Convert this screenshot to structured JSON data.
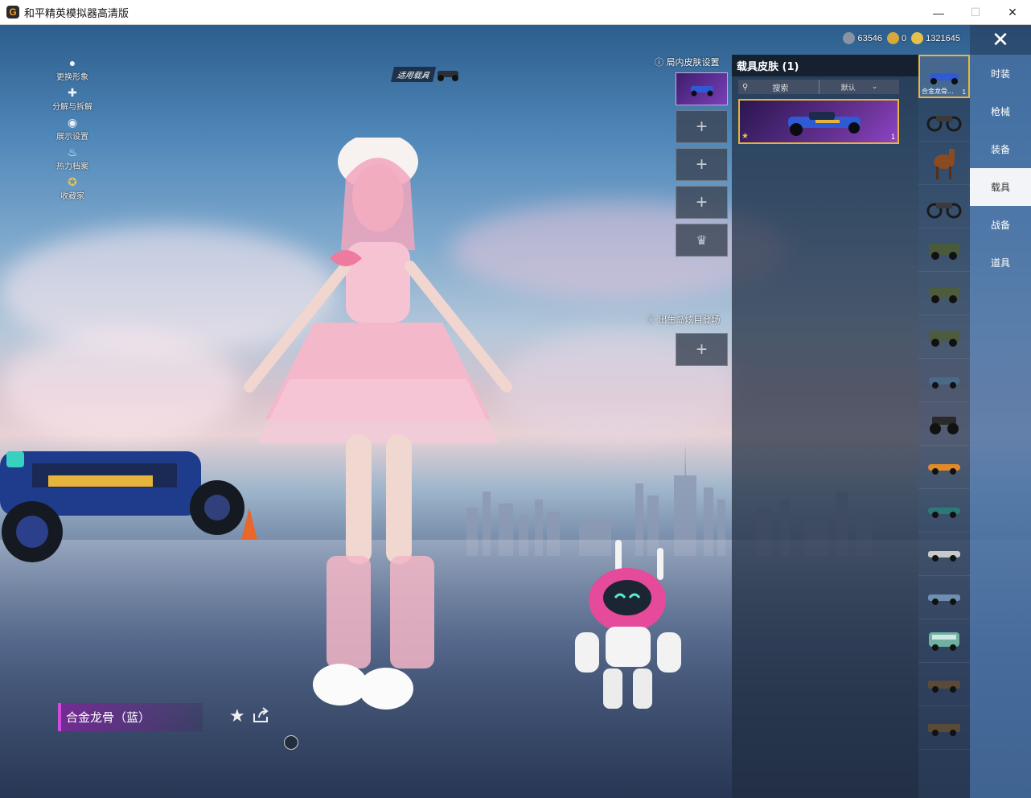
{
  "window": {
    "title": "和平精英模拟器高清版",
    "minimize": "—",
    "maximize": "☐",
    "close": "✕"
  },
  "left_menu": [
    {
      "label": "更换形象",
      "icon": "avatar-icon"
    },
    {
      "label": "分解与拆解",
      "icon": "puzzle-icon"
    },
    {
      "label": "展示设置",
      "icon": "eye-icon"
    },
    {
      "label": "热力档案",
      "icon": "flame-icon"
    },
    {
      "label": "收藏家",
      "icon": "collector-badge-icon"
    }
  ],
  "apply_vehicle_label": "适用载具",
  "currency": [
    {
      "value": "63546",
      "color": "#8a93a3"
    },
    {
      "value": "0",
      "color": "#d7a93a"
    },
    {
      "value": "1321645",
      "color": "#e8c14a"
    }
  ],
  "skin_slots": {
    "header": "局内皮肤设置",
    "spawn_header": "出生岛炫目登场",
    "add_symbol": "+"
  },
  "skin_panel": {
    "title": "载具皮肤 (1)",
    "search_label": "搜索",
    "sort_label": "默认",
    "card_count": "1"
  },
  "vehicle_list": {
    "selected_label": "合金龙骨...",
    "selected_count": "1"
  },
  "categories": [
    {
      "label": "时装",
      "active": false
    },
    {
      "label": "枪械",
      "active": false
    },
    {
      "label": "装备",
      "active": false
    },
    {
      "label": "载具",
      "active": true
    },
    {
      "label": "战备",
      "active": false
    },
    {
      "label": "道具",
      "active": false
    }
  ],
  "bottom": {
    "item_name": "合金龙骨（蓝）"
  },
  "colors": {
    "accent_gold": "#e6b33c",
    "accent_purple": "#d14bde"
  }
}
